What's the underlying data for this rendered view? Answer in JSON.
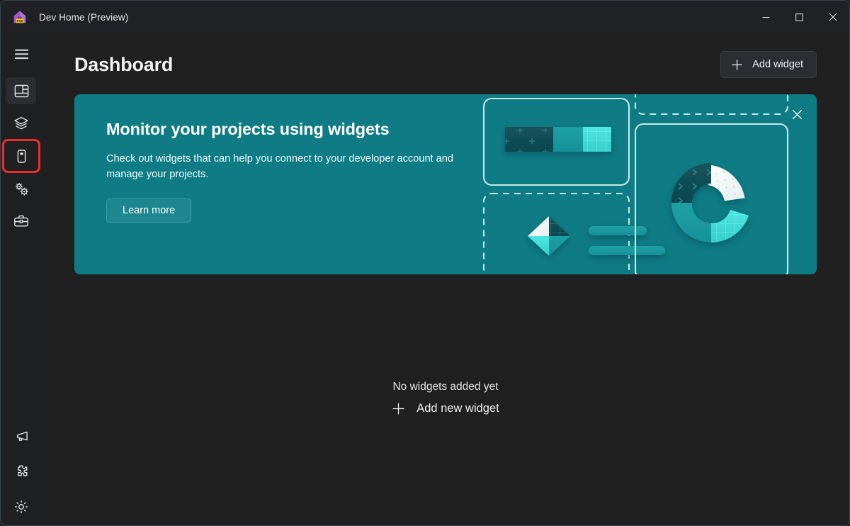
{
  "window": {
    "app_title": "Dev Home (Preview)",
    "logo_badge": "PRE",
    "minimize_label": "Minimize",
    "maximize_label": "Maximize",
    "close_label": "Close"
  },
  "sidebar": {
    "hamburger_label": "Navigation menu",
    "items": [
      {
        "id": "dashboard",
        "label": "Dashboard",
        "icon": "dashboard-grid-icon",
        "selected": true
      },
      {
        "id": "machine-configuration",
        "label": "Machine configuration",
        "icon": "layers-icon",
        "selected": false
      },
      {
        "id": "environments",
        "label": "Environments",
        "icon": "device-icon",
        "selected": false
      },
      {
        "id": "utilities",
        "label": "Utilities",
        "icon": "gears-icon",
        "selected": false
      },
      {
        "id": "toolbox",
        "label": "Toolbox",
        "icon": "toolbox-icon",
        "selected": false
      }
    ],
    "bottom_items": [
      {
        "id": "feedback",
        "label": "Send feedback",
        "icon": "megaphone-icon"
      },
      {
        "id": "extensions",
        "label": "Extensions",
        "icon": "puzzle-piece-icon"
      },
      {
        "id": "settings",
        "label": "Settings",
        "icon": "gear-icon"
      }
    ],
    "highlighted_item_id": "environments"
  },
  "header": {
    "title": "Dashboard",
    "add_widget_label": "Add widget",
    "add_widget_icon": "plus-icon"
  },
  "banner": {
    "heading": "Monitor your projects using widgets",
    "body": "Check out widgets that can help you connect to your developer account and manage your projects.",
    "learn_more_label": "Learn more",
    "close_icon": "close-icon"
  },
  "empty_state": {
    "title": "No widgets added yet",
    "add_label": "Add new widget",
    "add_icon": "plus-icon"
  },
  "colors": {
    "window_background": "#202020",
    "titlebar_background": "#202124",
    "sidebar_background": "#1f2022",
    "banner_teal": "#0f7c85",
    "accent_teal": "#4cc2c9",
    "bright_cyan": "#3ddbd8",
    "dark_teal": "#0d5b63",
    "highlight_red": "#ee2b2b",
    "text_primary": "#f2f2f2",
    "window_border": "#39434b"
  }
}
